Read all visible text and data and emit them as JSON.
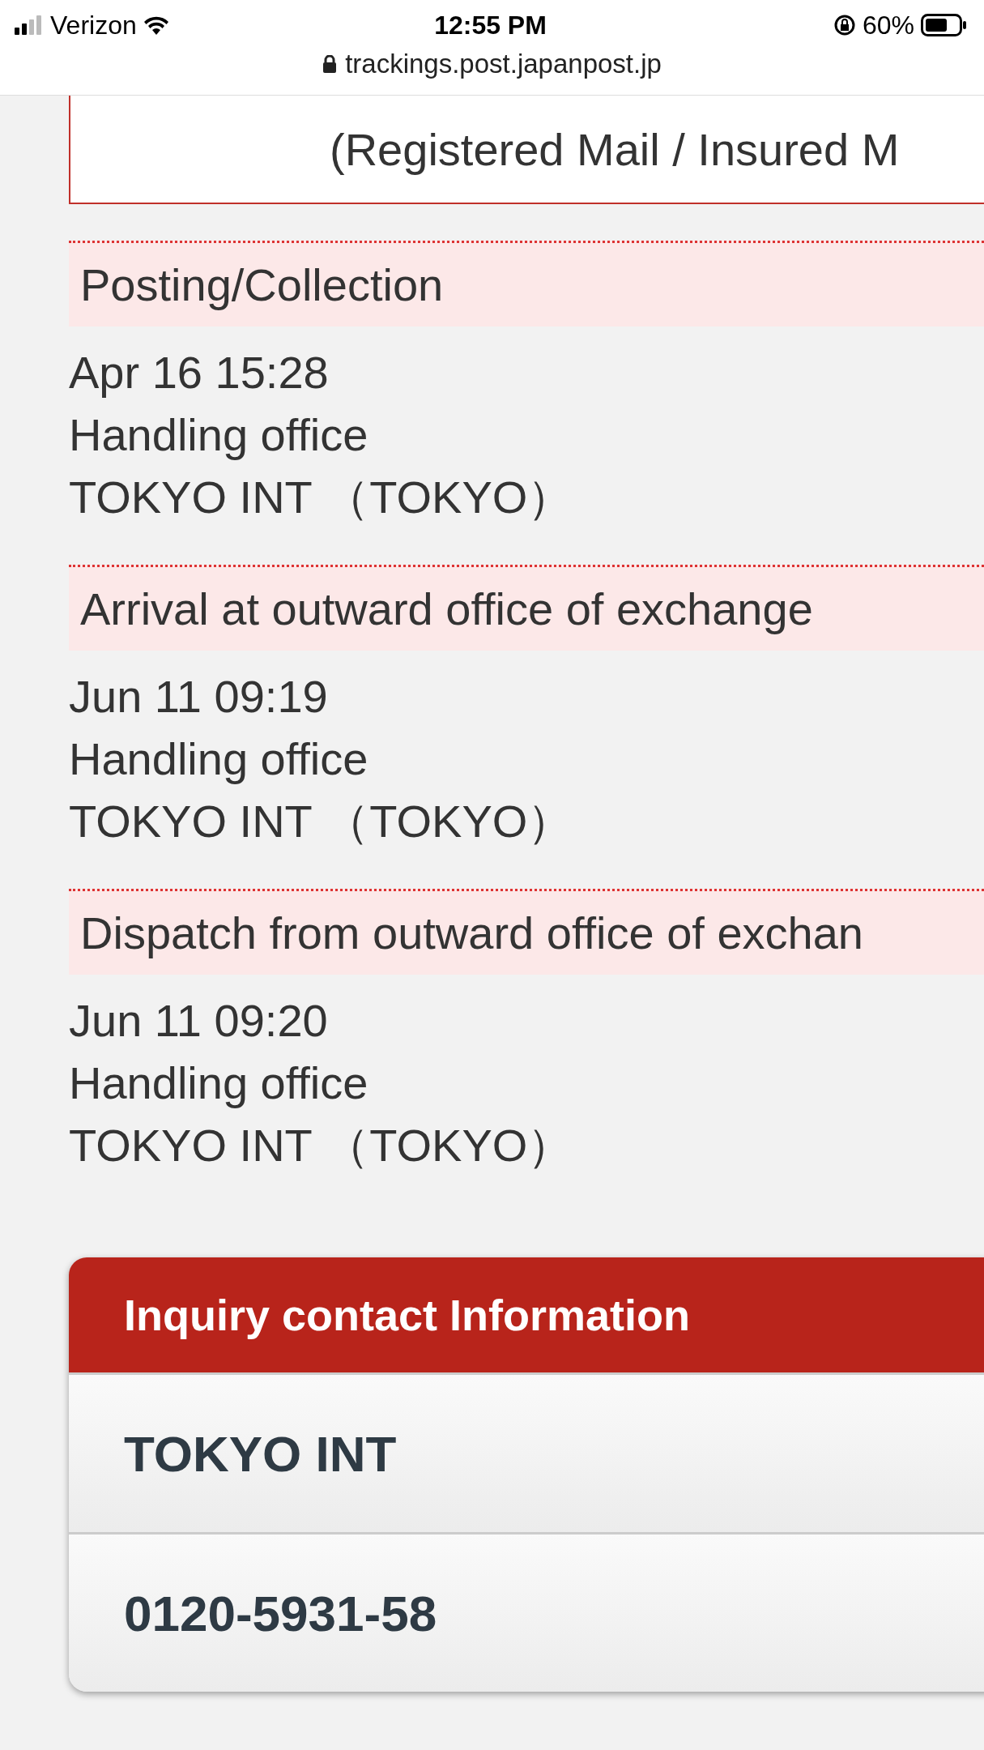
{
  "status_bar": {
    "carrier": "Verizon",
    "time": "12:55 PM",
    "battery": "60%",
    "url": "trackings.post.japanpost.jp"
  },
  "mail_type": "(Registered Mail / Insured M",
  "events": [
    {
      "status": "Posting/Collection",
      "date": "Apr 16 15:28",
      "office_label": "Handling office",
      "office": "TOKYO INT （TOKYO）"
    },
    {
      "status": "Arrival at outward office of exchange",
      "date": "Jun 11 09:19",
      "office_label": "Handling office",
      "office": "TOKYO INT （TOKYO）"
    },
    {
      "status": "Dispatch from outward office of exchan",
      "date": "Jun 11 09:20",
      "office_label": "Handling office",
      "office": "TOKYO INT （TOKYO）"
    }
  ],
  "contact": {
    "title": "Inquiry contact Information",
    "rows": [
      "TOKYO INT",
      "0120-5931-58"
    ]
  }
}
